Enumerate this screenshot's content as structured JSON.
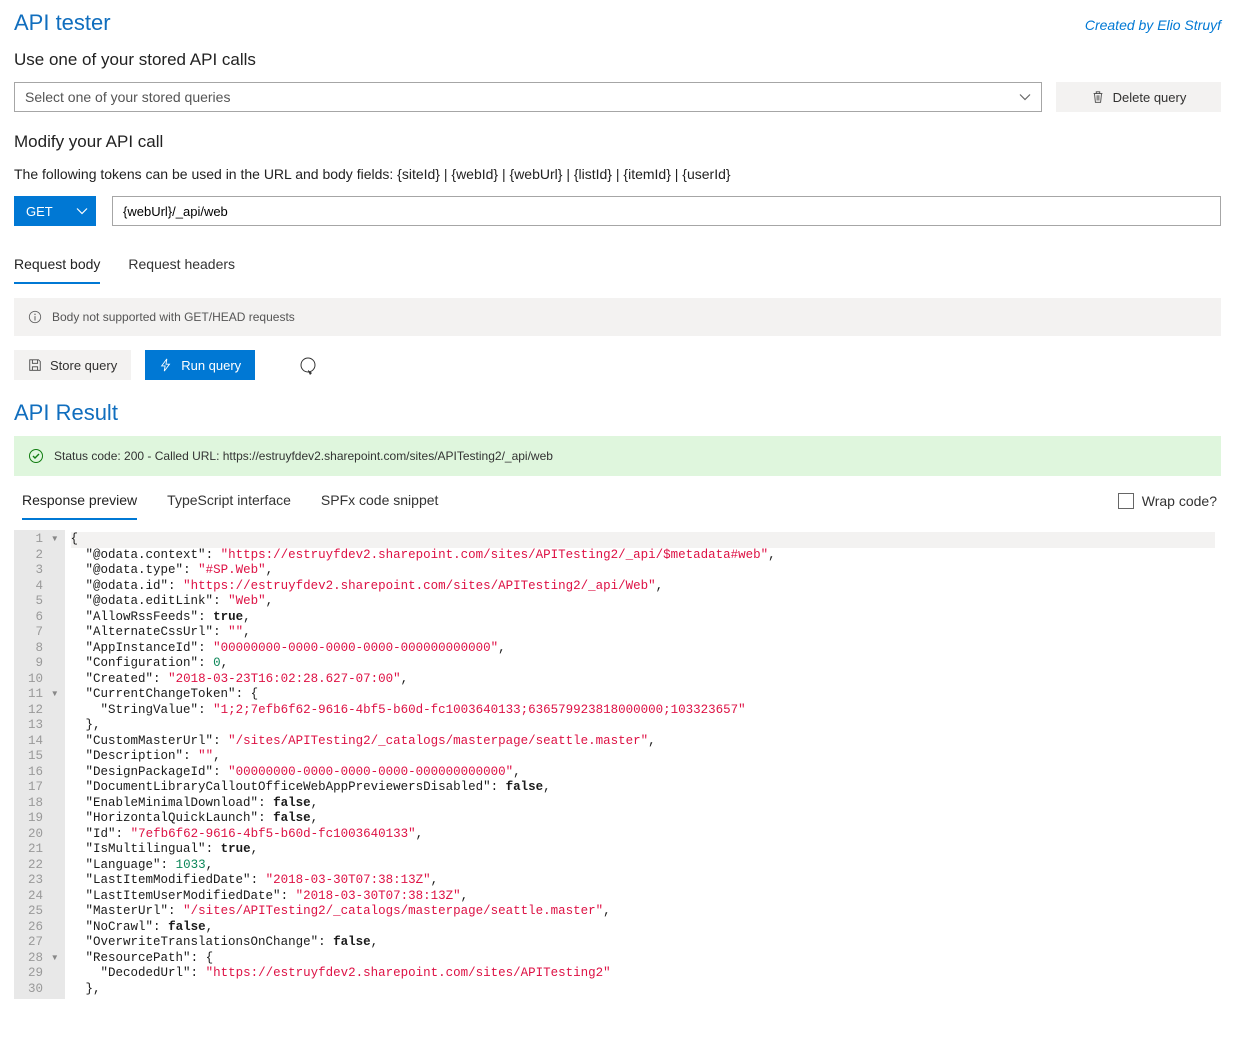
{
  "header": {
    "title": "API tester",
    "credit": "Created by Elio Struyf"
  },
  "stored": {
    "label": "Use one of your stored API calls",
    "placeholder": "Select one of your stored queries",
    "delete_label": "Delete query"
  },
  "modify": {
    "label": "Modify your API call",
    "tokens_text": "The following tokens can be used in the URL and body fields: {siteId} | {webId} | {webUrl} | {listId} | {itemId} | {userId}",
    "method": "GET",
    "url": "{webUrl}/_api/web"
  },
  "tabs": {
    "body": "Request body",
    "headers": "Request headers"
  },
  "body_info": "Body not supported with GET/HEAD requests",
  "actions": {
    "store": "Store query",
    "run": "Run query"
  },
  "result": {
    "title": "API Result",
    "status_text": "Status code: 200 - Called URL: https://estruyfdev2.sharepoint.com/sites/APITesting2/_api/web"
  },
  "response_tabs": {
    "preview": "Response preview",
    "ts": "TypeScript interface",
    "spfx": "SPFx code snippet"
  },
  "wrap_label": "Wrap code?",
  "code": [
    {
      "indent": 0,
      "key": null,
      "sym": "{",
      "fold": true
    },
    {
      "indent": 1,
      "key": "@odata.context",
      "type": "s",
      "val": "https://estruyfdev2.sharepoint.com/sites/APITesting2/_api/$metadata#web",
      "comma": true
    },
    {
      "indent": 1,
      "key": "@odata.type",
      "type": "s",
      "val": "#SP.Web",
      "comma": true
    },
    {
      "indent": 1,
      "key": "@odata.id",
      "type": "s",
      "val": "https://estruyfdev2.sharepoint.com/sites/APITesting2/_api/Web",
      "comma": true
    },
    {
      "indent": 1,
      "key": "@odata.editLink",
      "type": "s",
      "val": "Web",
      "comma": true
    },
    {
      "indent": 1,
      "key": "AllowRssFeeds",
      "type": "b",
      "val": "true",
      "comma": true
    },
    {
      "indent": 1,
      "key": "AlternateCssUrl",
      "type": "s",
      "val": "",
      "comma": true
    },
    {
      "indent": 1,
      "key": "AppInstanceId",
      "type": "s",
      "val": "00000000-0000-0000-0000-000000000000",
      "comma": true
    },
    {
      "indent": 1,
      "key": "Configuration",
      "type": "n",
      "val": "0",
      "comma": true
    },
    {
      "indent": 1,
      "key": "Created",
      "type": "s",
      "val": "2018-03-23T16:02:28.627-07:00",
      "comma": true
    },
    {
      "indent": 1,
      "key": "CurrentChangeToken",
      "sym": "{",
      "fold": true
    },
    {
      "indent": 2,
      "key": "StringValue",
      "type": "s",
      "val": "1;2;7efb6f62-9616-4bf5-b60d-fc1003640133;636579923818000000;103323657"
    },
    {
      "indent": 1,
      "sym": "},",
      "key": null
    },
    {
      "indent": 1,
      "key": "CustomMasterUrl",
      "type": "s",
      "val": "/sites/APITesting2/_catalogs/masterpage/seattle.master",
      "comma": true
    },
    {
      "indent": 1,
      "key": "Description",
      "type": "s",
      "val": "",
      "comma": true
    },
    {
      "indent": 1,
      "key": "DesignPackageId",
      "type": "s",
      "val": "00000000-0000-0000-0000-000000000000",
      "comma": true
    },
    {
      "indent": 1,
      "key": "DocumentLibraryCalloutOfficeWebAppPreviewersDisabled",
      "type": "b",
      "val": "false",
      "comma": true
    },
    {
      "indent": 1,
      "key": "EnableMinimalDownload",
      "type": "b",
      "val": "false",
      "comma": true
    },
    {
      "indent": 1,
      "key": "HorizontalQuickLaunch",
      "type": "b",
      "val": "false",
      "comma": true
    },
    {
      "indent": 1,
      "key": "Id",
      "type": "s",
      "val": "7efb6f62-9616-4bf5-b60d-fc1003640133",
      "comma": true
    },
    {
      "indent": 1,
      "key": "IsMultilingual",
      "type": "b",
      "val": "true",
      "comma": true
    },
    {
      "indent": 1,
      "key": "Language",
      "type": "n",
      "val": "1033",
      "comma": true
    },
    {
      "indent": 1,
      "key": "LastItemModifiedDate",
      "type": "s",
      "val": "2018-03-30T07:38:13Z",
      "comma": true
    },
    {
      "indent": 1,
      "key": "LastItemUserModifiedDate",
      "type": "s",
      "val": "2018-03-30T07:38:13Z",
      "comma": true
    },
    {
      "indent": 1,
      "key": "MasterUrl",
      "type": "s",
      "val": "/sites/APITesting2/_catalogs/masterpage/seattle.master",
      "comma": true
    },
    {
      "indent": 1,
      "key": "NoCrawl",
      "type": "b",
      "val": "false",
      "comma": true
    },
    {
      "indent": 1,
      "key": "OverwriteTranslationsOnChange",
      "type": "b",
      "val": "false",
      "comma": true
    },
    {
      "indent": 1,
      "key": "ResourcePath",
      "sym": "{",
      "fold": true
    },
    {
      "indent": 2,
      "key": "DecodedUrl",
      "type": "s",
      "val": "https://estruyfdev2.sharepoint.com/sites/APITesting2"
    },
    {
      "indent": 1,
      "sym": "},",
      "key": null
    }
  ]
}
